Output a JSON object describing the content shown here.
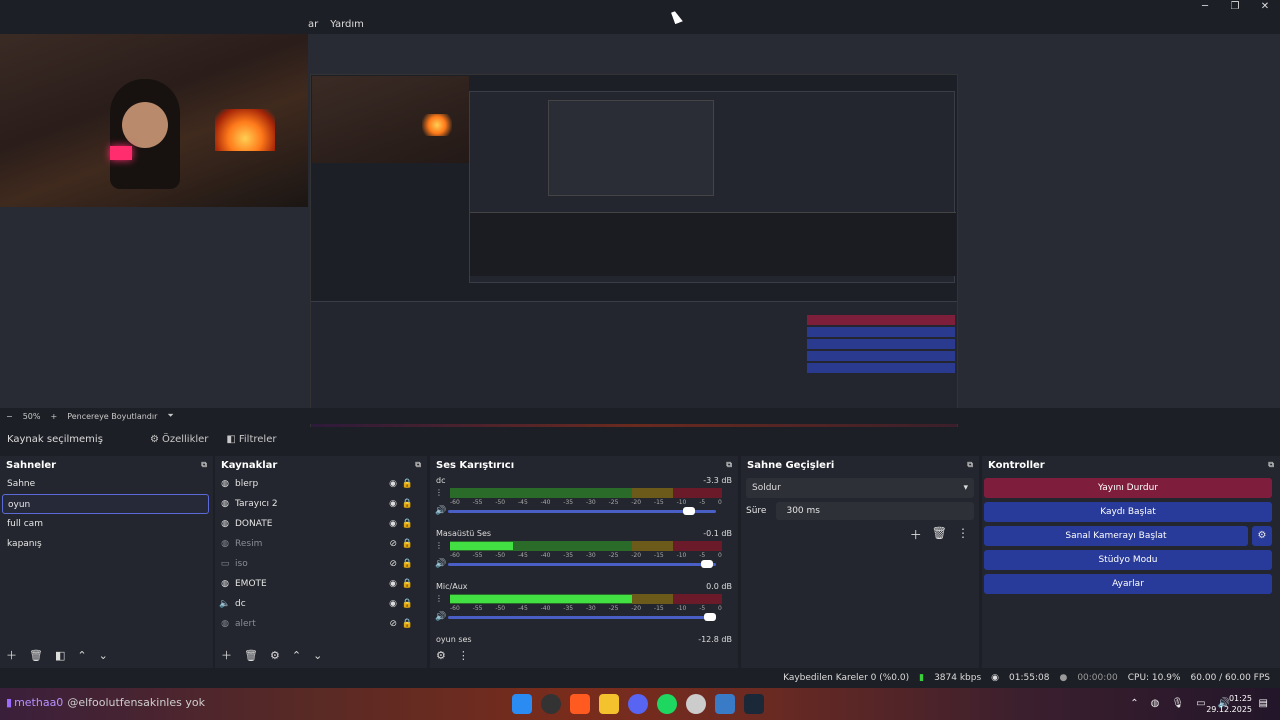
{
  "menu": {
    "items": [
      "ar",
      "Yardım"
    ]
  },
  "window_controls": {
    "minimize": "─",
    "maximize": "❐",
    "close": "✕"
  },
  "zoombar": {
    "minus": "−",
    "zoom": "50%",
    "plus": "+",
    "mode": "Pencereye Boyutlandır",
    "caret": "⏷"
  },
  "context": {
    "label": "Kaynak seçilmemiş",
    "properties": "Özellikler",
    "filters": "Filtreler"
  },
  "scenes": {
    "title": "Sahneler",
    "items": [
      "Sahne",
      "oyun",
      "full cam",
      "kapanış"
    ],
    "selected_index": 1
  },
  "sources": {
    "title": "Kaynaklar",
    "items": [
      {
        "name": "blerp",
        "icon": "browser-icon",
        "visible": true
      },
      {
        "name": "Tarayıcı 2",
        "icon": "browser-icon",
        "visible": true
      },
      {
        "name": "DONATE",
        "icon": "browser-icon",
        "visible": true
      },
      {
        "name": "Resim",
        "icon": "browser-icon",
        "visible": false
      },
      {
        "name": "iso",
        "icon": "image-icon",
        "visible": false
      },
      {
        "name": "EMOTE",
        "icon": "browser-icon",
        "visible": true
      },
      {
        "name": "dc",
        "icon": "audio-icon",
        "visible": true
      },
      {
        "name": "alert",
        "icon": "browser-icon",
        "visible": false
      }
    ]
  },
  "mixer": {
    "title": "Ses Karıştırıcı",
    "scale": [
      "-60",
      "-55",
      "-50",
      "-45",
      "-40",
      "-35",
      "-30",
      "-25",
      "-20",
      "-15",
      "-10",
      "-5",
      "0"
    ],
    "channels": [
      {
        "name": "dc",
        "db": "-3.3 dB",
        "level": 0.0,
        "volume": 0.92
      },
      {
        "name": "Masaüstü Ses",
        "db": "-0.1 dB",
        "level": 0.23,
        "volume": 0.99
      },
      {
        "name": "Mic/Aux",
        "db": "0.0 dB",
        "level": 0.67,
        "volume": 1.0
      },
      {
        "name": "oyun ses",
        "db": "-12.8 dB",
        "level": 0.0,
        "volume": 0.8
      }
    ]
  },
  "transitions": {
    "title": "Sahne Geçişleri",
    "type": "Soldur",
    "duration_label": "Süre",
    "duration": "300 ms"
  },
  "controls": {
    "title": "Kontroller",
    "stop_stream": "Yayını Durdur",
    "start_recording": "Kaydı Başlat",
    "virtual_camera": "Sanal Kamerayı Başlat",
    "studio_mode": "Stüdyo Modu",
    "settings": "Ayarlar"
  },
  "status": {
    "dropped": "Kaybedilen Kareler 0 (%0.0)",
    "bitrate": "3874 kbps",
    "stream_time": "01:55:08",
    "rec_time": "00:00:00",
    "cpu": "CPU: 10.9%",
    "fps": "60.00 / 60.00 FPS"
  },
  "taskbar": {
    "user": "methaa0",
    "message": "@elfoolutfensakinles yok",
    "time": "01:25",
    "date": "29.12.2025"
  },
  "colors": {
    "accent": "#283a9a",
    "stop": "#7e1d3c",
    "meter_green": "#42e042"
  }
}
